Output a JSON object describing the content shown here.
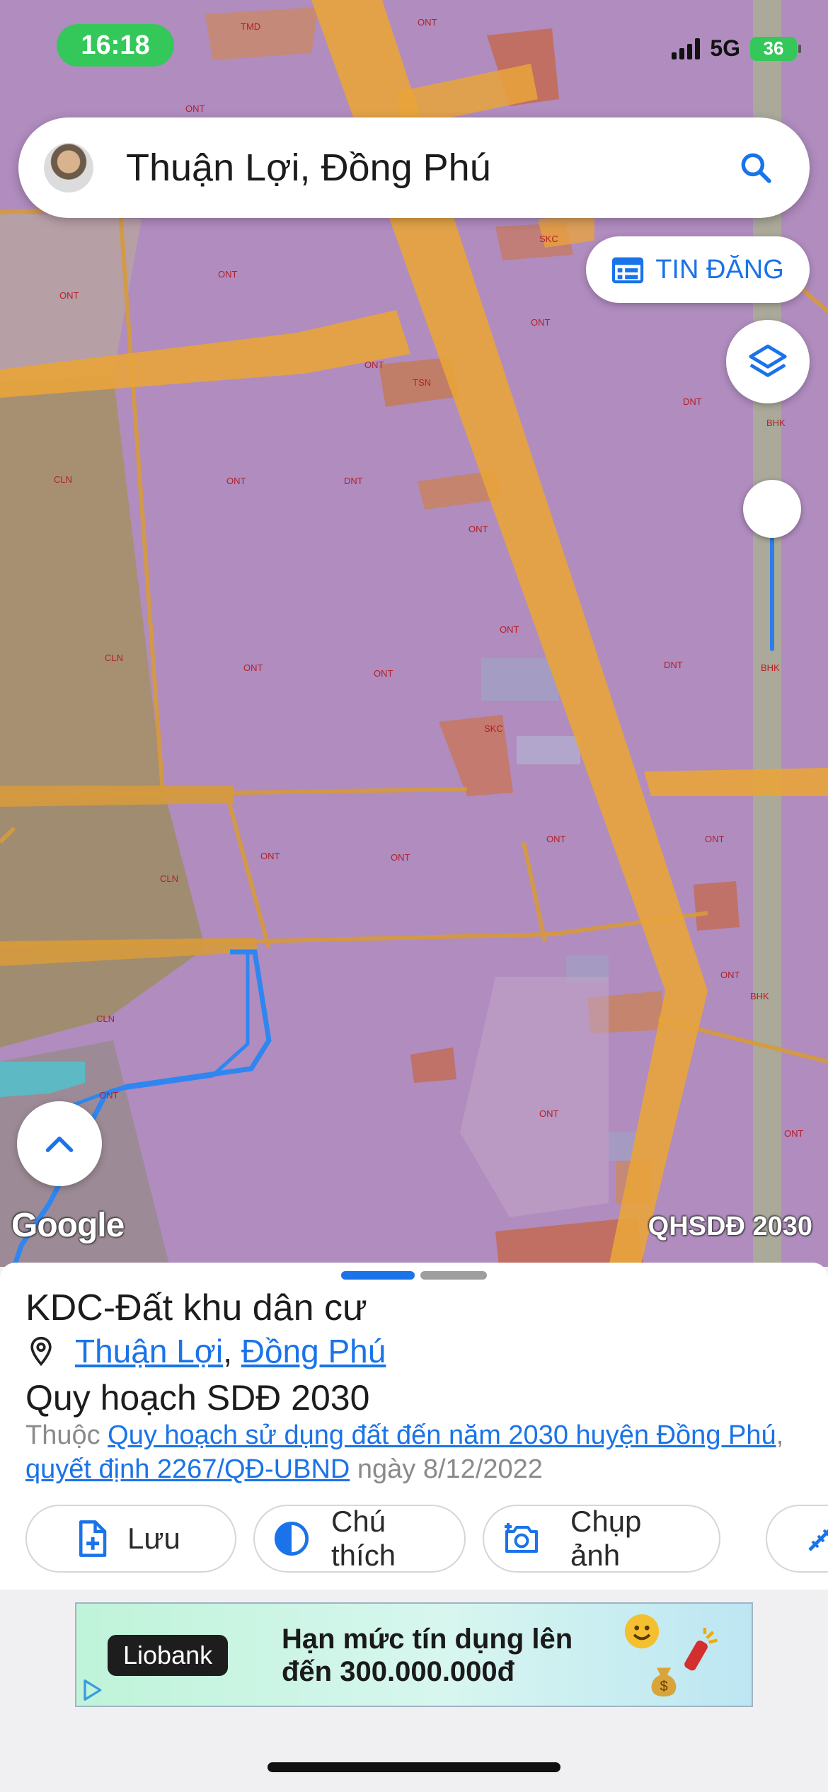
{
  "status_bar": {
    "time": "16:18",
    "network": "5G",
    "battery": "36"
  },
  "search": {
    "text": "Thuận Lợi, Đồng Phú"
  },
  "map": {
    "tin_dang_label": "TIN ĐĂNG",
    "google_logo": "Google",
    "plan_label": "QHSDĐ 2030",
    "opacity_level": 1.0,
    "zone_codes": {
      "tmd": "TMD",
      "ont": "ONT",
      "cln": "CLN",
      "skc": "SKC",
      "tsn": "TSN",
      "dnt": "DNT",
      "bhk": "BHK"
    },
    "colors": {
      "residential": "#b08cbf",
      "road": "#e9a43a",
      "perennial": "#b49a6e",
      "industrial": "#cf7a56",
      "selection": "#2f86f0"
    }
  },
  "sheet": {
    "title": "KDC-Đất khu dân cư",
    "location": {
      "commune": "Thuận Lợi",
      "separator": ", ",
      "district": "Đồng Phú"
    },
    "plan_name": "Quy hoạch SDĐ 2030",
    "plan_desc": {
      "prefix": "Thuộc ",
      "plan_link": "Quy hoạch sử dụng đất đến năm 2030 huyện Đồng Phú",
      "comma": ", ",
      "decision_link": "quyết định 2267/QĐ-UBND",
      "date": " ngày 8/12/2022"
    },
    "actions": [
      {
        "label": "Lưu",
        "icon": "file-add-icon"
      },
      {
        "label": "Chú thích",
        "icon": "half-circle-icon"
      },
      {
        "label": "Chụp ảnh",
        "icon": "camera-add-icon"
      }
    ]
  },
  "ad": {
    "brand": "Liobank",
    "line1": "Hạn mức tín dụng lên",
    "line2": "đến 300.000.000đ"
  }
}
